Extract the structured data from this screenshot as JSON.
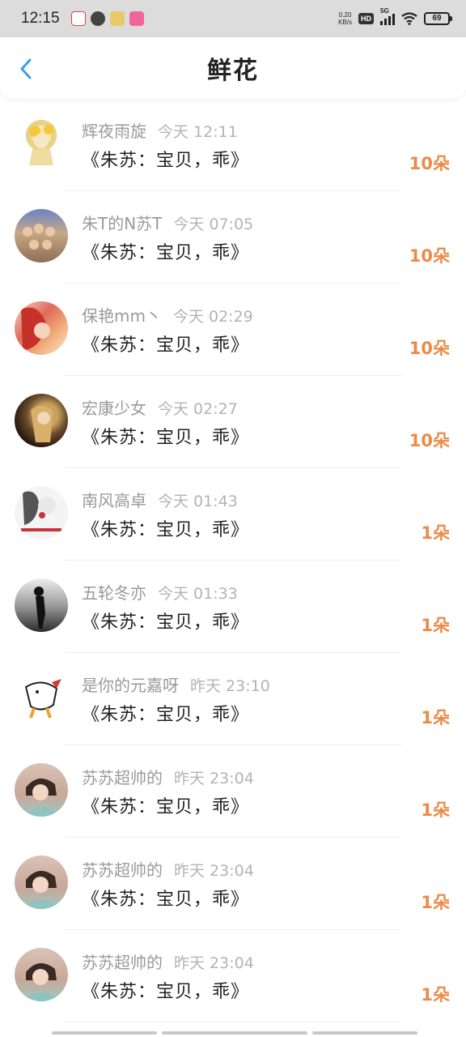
{
  "status_bar": {
    "time": "12:15",
    "net_speed_value": "0.20",
    "net_speed_unit": "KB/s",
    "hd": "HD",
    "network": "5G",
    "battery": "69"
  },
  "header": {
    "title": "鲜花",
    "back_icon": "chevron-left-icon"
  },
  "colors": {
    "accent": "#3b9cf0",
    "count": "#ec8a47"
  },
  "gifts": [
    {
      "name": "辉夜雨旋",
      "time": "今天 12:11",
      "message": "《朱苏：宝贝，乖》",
      "count": "10朵"
    },
    {
      "name": "朱T的N苏T",
      "time": "今天 07:05",
      "message": "《朱苏：宝贝，乖》",
      "count": "10朵"
    },
    {
      "name": "保艳mm丶",
      "time": "今天 02:29",
      "message": "《朱苏：宝贝，乖》",
      "count": "10朵"
    },
    {
      "name": "宏康少女",
      "time": "今天 02:27",
      "message": "《朱苏：宝贝，乖》",
      "count": "10朵"
    },
    {
      "name": "南风高卓",
      "time": "今天 01:43",
      "message": "《朱苏：宝贝，乖》",
      "count": "1朵"
    },
    {
      "name": "五轮冬亦",
      "time": "今天 01:33",
      "message": "《朱苏：宝贝，乖》",
      "count": "1朵"
    },
    {
      "name": "是你的元嘉呀",
      "time": "昨天 23:10",
      "message": "《朱苏：宝贝，乖》",
      "count": "1朵"
    },
    {
      "name": "苏苏超帅的",
      "time": "昨天 23:04",
      "message": "《朱苏：宝贝，乖》",
      "count": "1朵"
    },
    {
      "name": "苏苏超帅的",
      "time": "昨天 23:04",
      "message": "《朱苏：宝贝，乖》",
      "count": "1朵"
    },
    {
      "name": "苏苏超帅的",
      "time": "昨天 23:04",
      "message": "《朱苏：宝贝，乖》",
      "count": "1朵"
    }
  ]
}
